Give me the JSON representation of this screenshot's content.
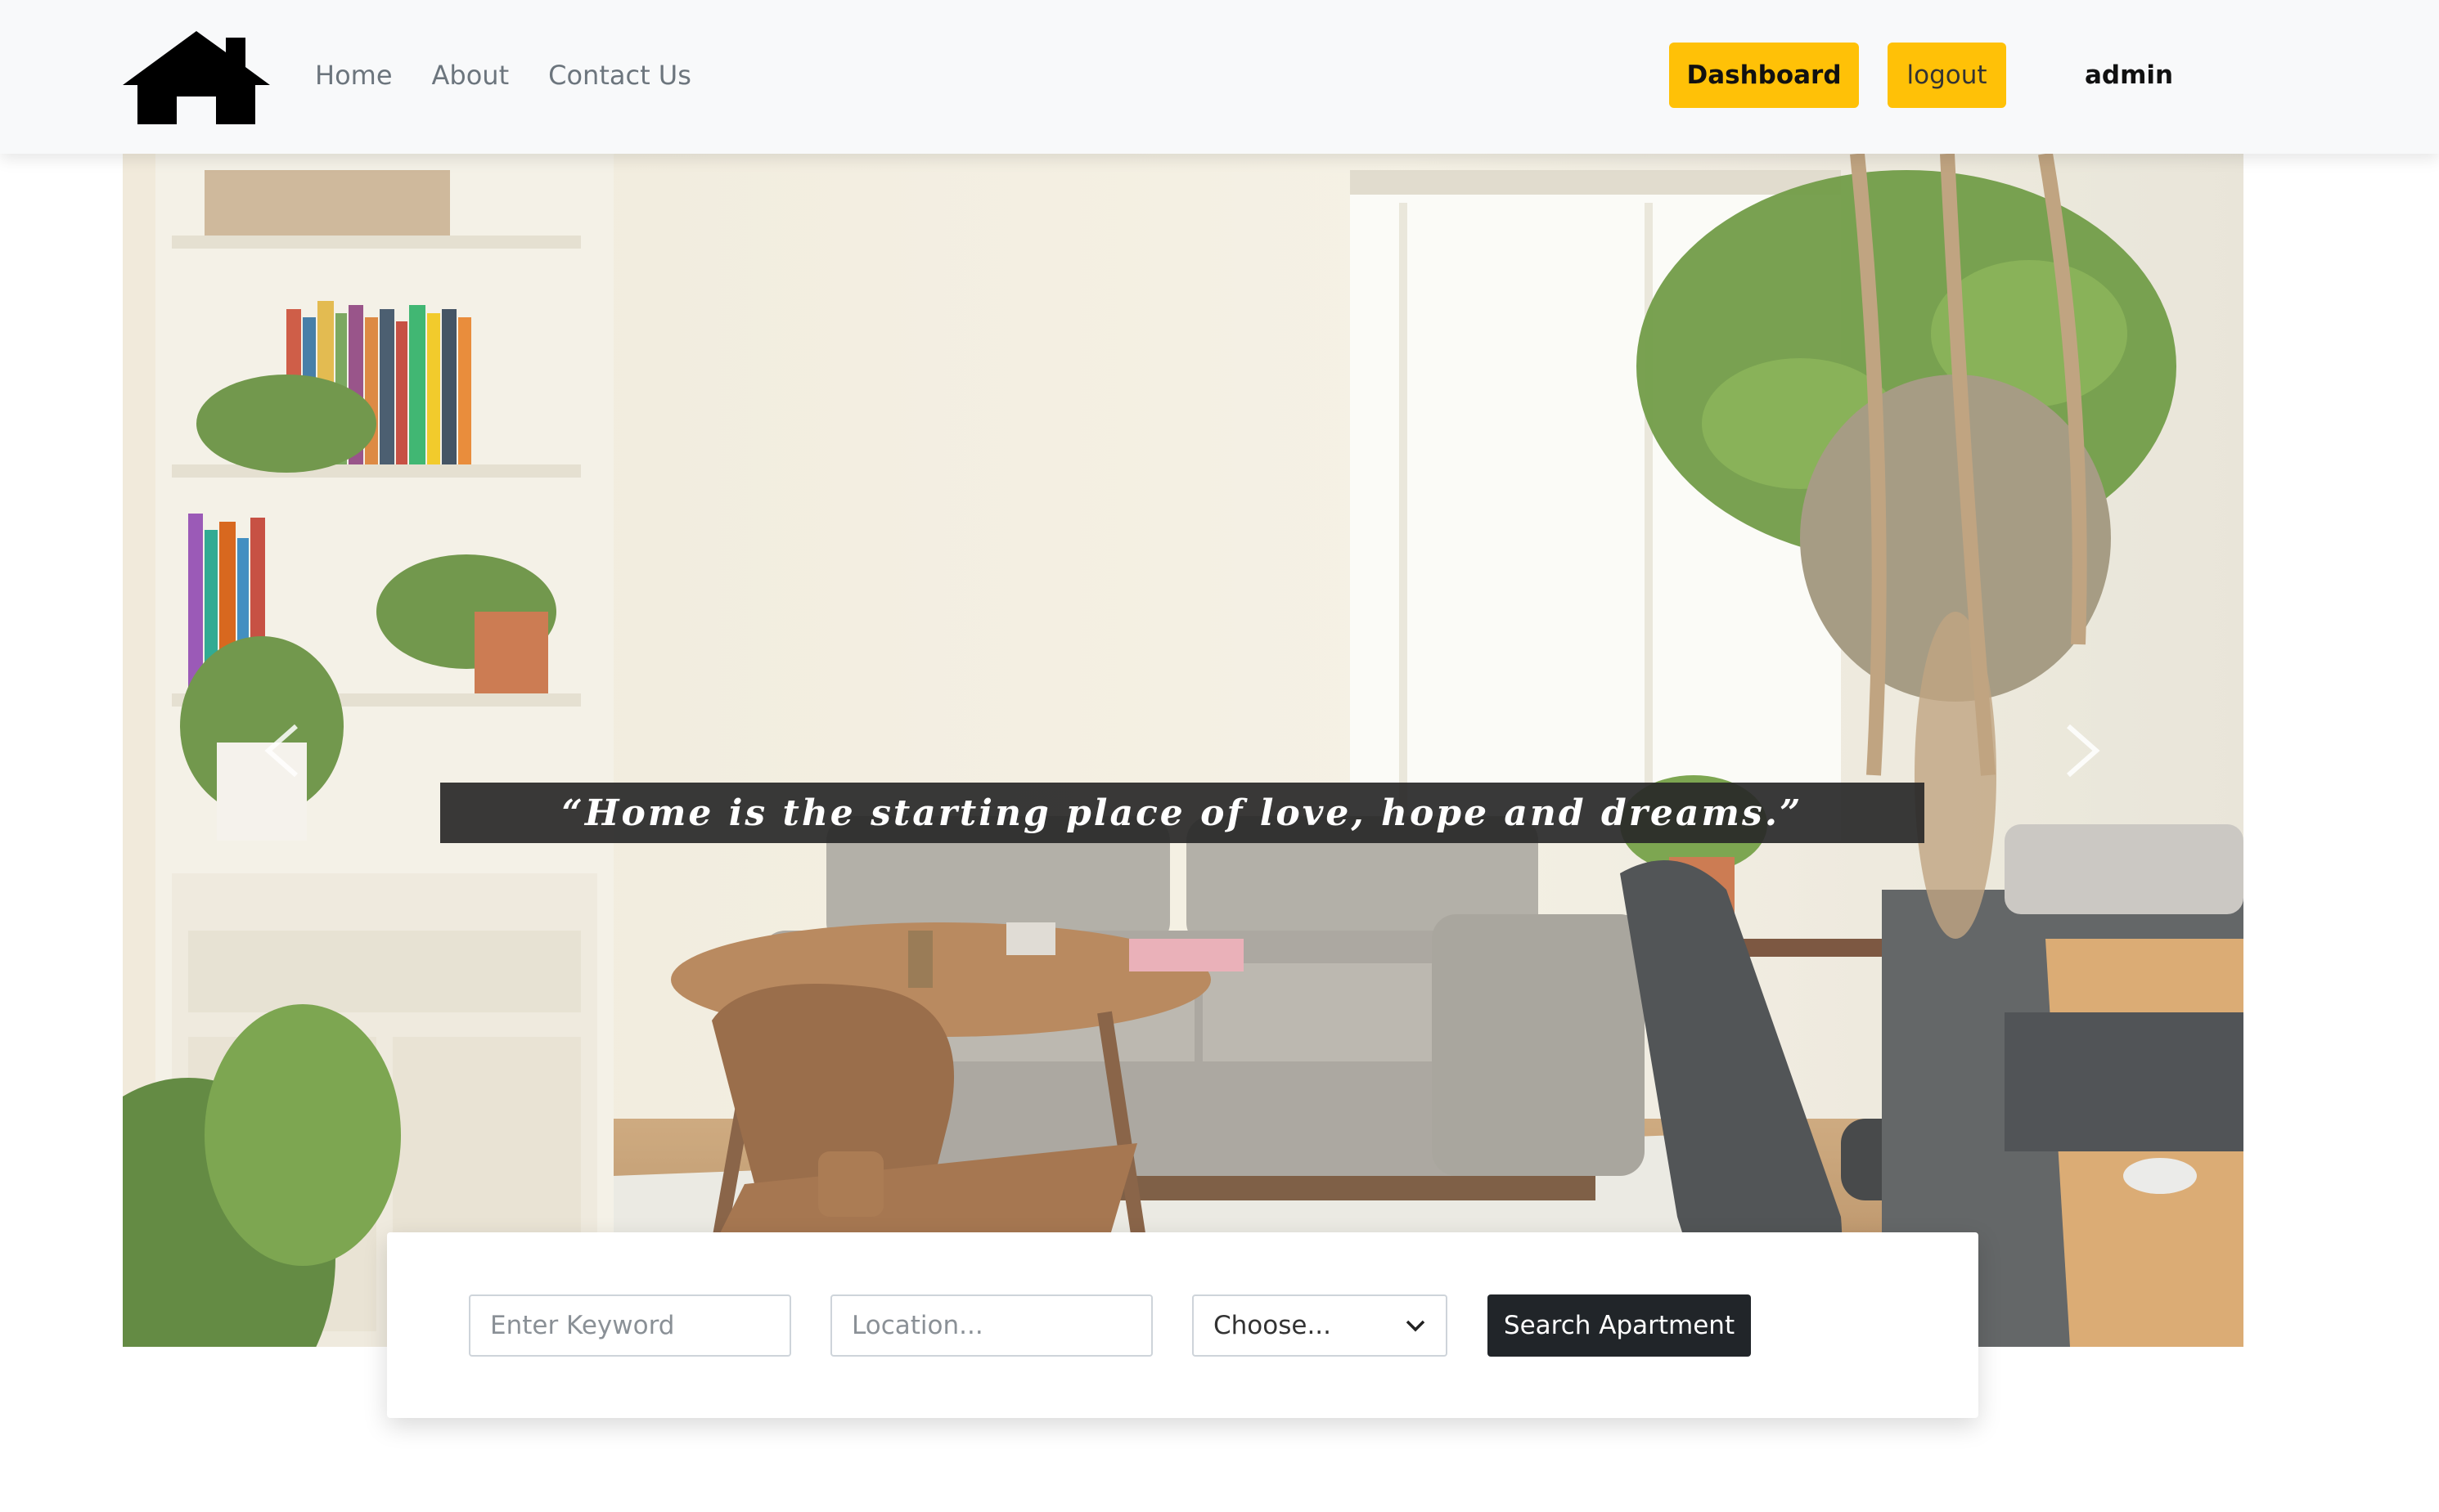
{
  "navbar": {
    "logo_icon": "house-icon",
    "links": [
      "Home",
      "About",
      "Contact Us"
    ],
    "dashboard_label": "Dashboard",
    "logout_label": "logout",
    "user": "admin",
    "accent_color": "#ffc107"
  },
  "hero": {
    "image_subject": "living room",
    "quote": "“Home is the starting place of love, hope and dreams.”",
    "prev_icon": "chevron-left-icon",
    "next_icon": "chevron-right-icon"
  },
  "search": {
    "keyword_placeholder": "Enter Keyword",
    "location_placeholder": "Location...",
    "select_value": "Choose...",
    "select_icon": "chevron-down-icon",
    "button_label": "Search Apartment",
    "button_color": "#212529"
  }
}
